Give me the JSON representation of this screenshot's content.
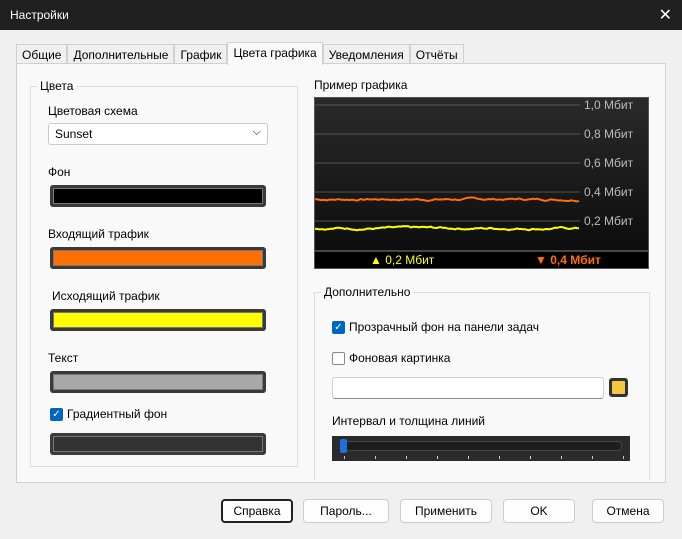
{
  "window": {
    "title": "Настройки"
  },
  "tabs": [
    "Общие",
    "Дополнительные",
    "График",
    "Цвета графика",
    "Уведомления",
    "Отчёты"
  ],
  "colors_group": {
    "title": "Цвета",
    "scheme_label": "Цветовая схема",
    "scheme_value": "Sunset",
    "background_label": "Фон",
    "incoming_label": "Входящий трафик",
    "outgoing_label": "Исходящий трафик",
    "text_label": "Текст",
    "gradient_label": "Градиентный фон",
    "gradient_checked": true
  },
  "swatch_colors": {
    "background": "#000000",
    "incoming": "#ff7000",
    "outgoing": "#ffff00",
    "text": "#a8a8a8",
    "gradient": "#333333"
  },
  "preview": {
    "title": "Пример графика",
    "legend_up": "▲ 0,2 Мбит",
    "legend_down": "▼ 0,4 Мбит"
  },
  "chart_data": {
    "type": "line",
    "y_ticks": [
      "1,0 Мбит",
      "0,8 Мбит",
      "0,6 Мбит",
      "0,4 Мбит",
      "0,2 Мбит"
    ],
    "ylim": [
      0,
      1.0
    ],
    "series": [
      {
        "name": "incoming",
        "color": "#ff7000",
        "mean": 0.35
      },
      {
        "name": "outgoing",
        "color": "#ffff00",
        "mean": 0.15
      }
    ]
  },
  "extra": {
    "title": "Дополнительно",
    "transparent_label": "Прозрачный фон на панели задач",
    "transparent_checked": true,
    "bgimage_label": "Фоновая картинка",
    "bgimage_checked": false,
    "path_value": "",
    "interval_label": "Интервал и толщина линий",
    "slider_value": 0
  },
  "buttons": {
    "help": "Справка",
    "password": "Пароль...",
    "apply": "Применить",
    "ok": "OK",
    "cancel": "Отмена"
  }
}
